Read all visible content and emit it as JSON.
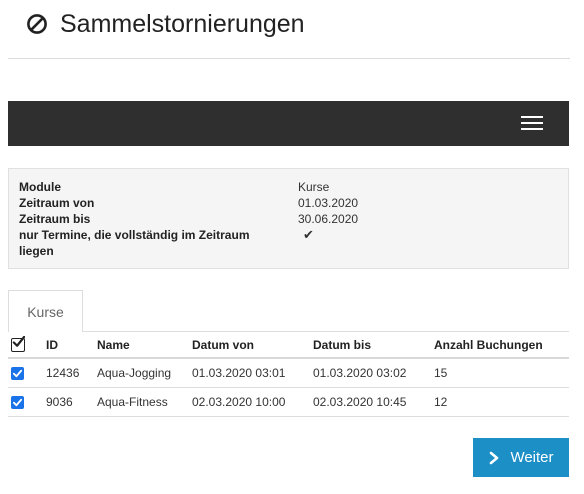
{
  "header": {
    "title": "Sammelstornierungen",
    "icon": "cancel-circle-icon"
  },
  "navbar": {
    "menu_icon": "hamburger-menu-icon"
  },
  "summary": {
    "rows": [
      {
        "label": "Module",
        "value": "Kurse"
      },
      {
        "label": "Zeitraum von",
        "value": "01.03.2020"
      },
      {
        "label": "Zeitraum bis",
        "value": "30.06.2020"
      },
      {
        "label": "nur Termine, die vollständig im Zeitraum liegen",
        "value": "✔"
      }
    ]
  },
  "tabs": [
    {
      "label": "Kurse",
      "active": true
    }
  ],
  "table": {
    "columns": [
      "ID",
      "Name",
      "Datum von",
      "Datum bis",
      "Anzahl Buchungen"
    ],
    "rows": [
      {
        "checked": true,
        "id": "12436",
        "name": "Aqua-Jogging",
        "datum_von": "01.03.2020 03:01",
        "datum_bis": "01.03.2020 03:02",
        "anzahl": "15"
      },
      {
        "checked": true,
        "id": "9036",
        "name": "Aqua-Fitness",
        "datum_von": "02.03.2020 10:00",
        "datum_bis": "02.03.2020 10:45",
        "anzahl": "12"
      }
    ]
  },
  "actions": {
    "next_label": "Weiter"
  },
  "colors": {
    "navbar": "#2f2f2f",
    "primary_button": "#1d8fc7",
    "checkbox": "#1a73e8",
    "check_green": "#3aa64a"
  }
}
